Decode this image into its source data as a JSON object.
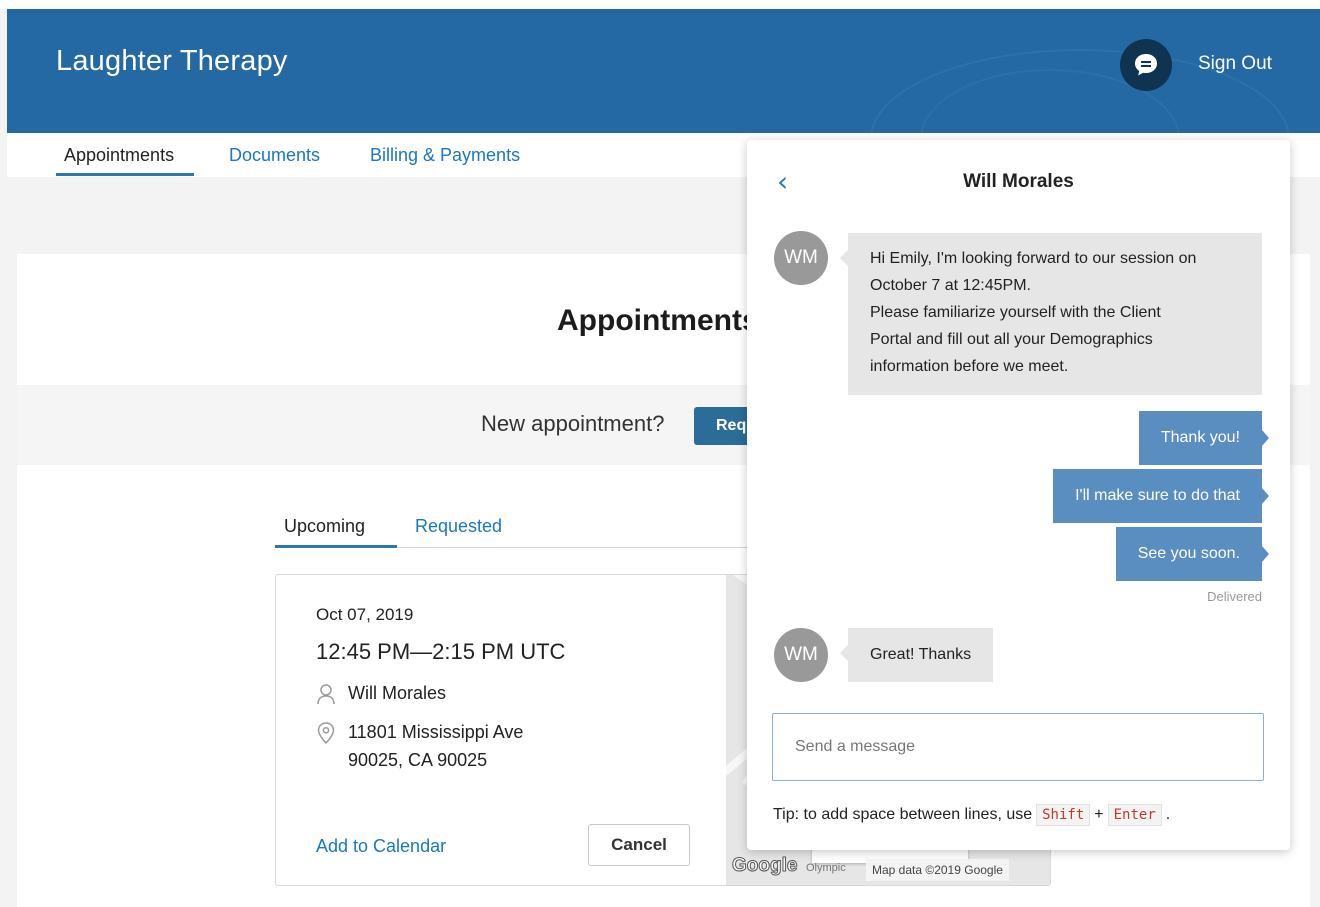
{
  "app": {
    "title": "Laughter Therapy",
    "sign_out": "Sign Out"
  },
  "nav": {
    "tabs": [
      {
        "label": "Appointments",
        "active": true
      },
      {
        "label": "Documents",
        "active": false
      },
      {
        "label": "Billing & Payments",
        "active": false
      }
    ]
  },
  "main": {
    "title": "Appointments",
    "new_appointment_prompt": "New appointment?",
    "request_button": "Request",
    "subtabs": [
      {
        "label": "Upcoming",
        "active": true
      },
      {
        "label": "Requested",
        "active": false
      }
    ],
    "appointment": {
      "date": "Oct 07, 2019",
      "time": "12:45 PM—2:15 PM UTC",
      "clinician": "Will Morales",
      "address_line1": "11801 Mississippi Ave",
      "address_line2": "90025, CA 90025",
      "add_to_calendar": "Add to Calendar",
      "cancel": "Cancel"
    },
    "map": {
      "logo": "Google",
      "place_label": "Olympic",
      "attribution": "Map data ©2019 Google"
    }
  },
  "chat": {
    "title": "Will Morales",
    "avatar_initials": "WM",
    "messages": {
      "m1_line1": "Hi Emily, I'm looking forward to our session on",
      "m1_line2": "October 7 at 12:45PM.",
      "m1_line3": "Please familiarize yourself with the Client",
      "m1_line4": "Portal and fill out all your Demographics",
      "m1_line5": "information before we meet.",
      "m2": "Thank you!",
      "m3": "I'll make sure to do that",
      "m4": "See you soon.",
      "m5": "Great! Thanks"
    },
    "delivered": "Delivered",
    "input_placeholder": "Send a message",
    "tip_prefix": "Tip: to add space between lines, use",
    "tip_key1": "Shift",
    "tip_plus": "+",
    "tip_key2": "Enter",
    "tip_suffix": "."
  },
  "colors": {
    "header": "#2468a4",
    "accent": "#1a78c2",
    "chat_icon_bg": "#0f3350",
    "outgoing_bubble": "#5a8ec1"
  },
  "icons": {
    "chat": "chat-bubble-icon",
    "person": "person-icon",
    "location": "location-pin-icon",
    "back": "chevron-left-icon"
  }
}
